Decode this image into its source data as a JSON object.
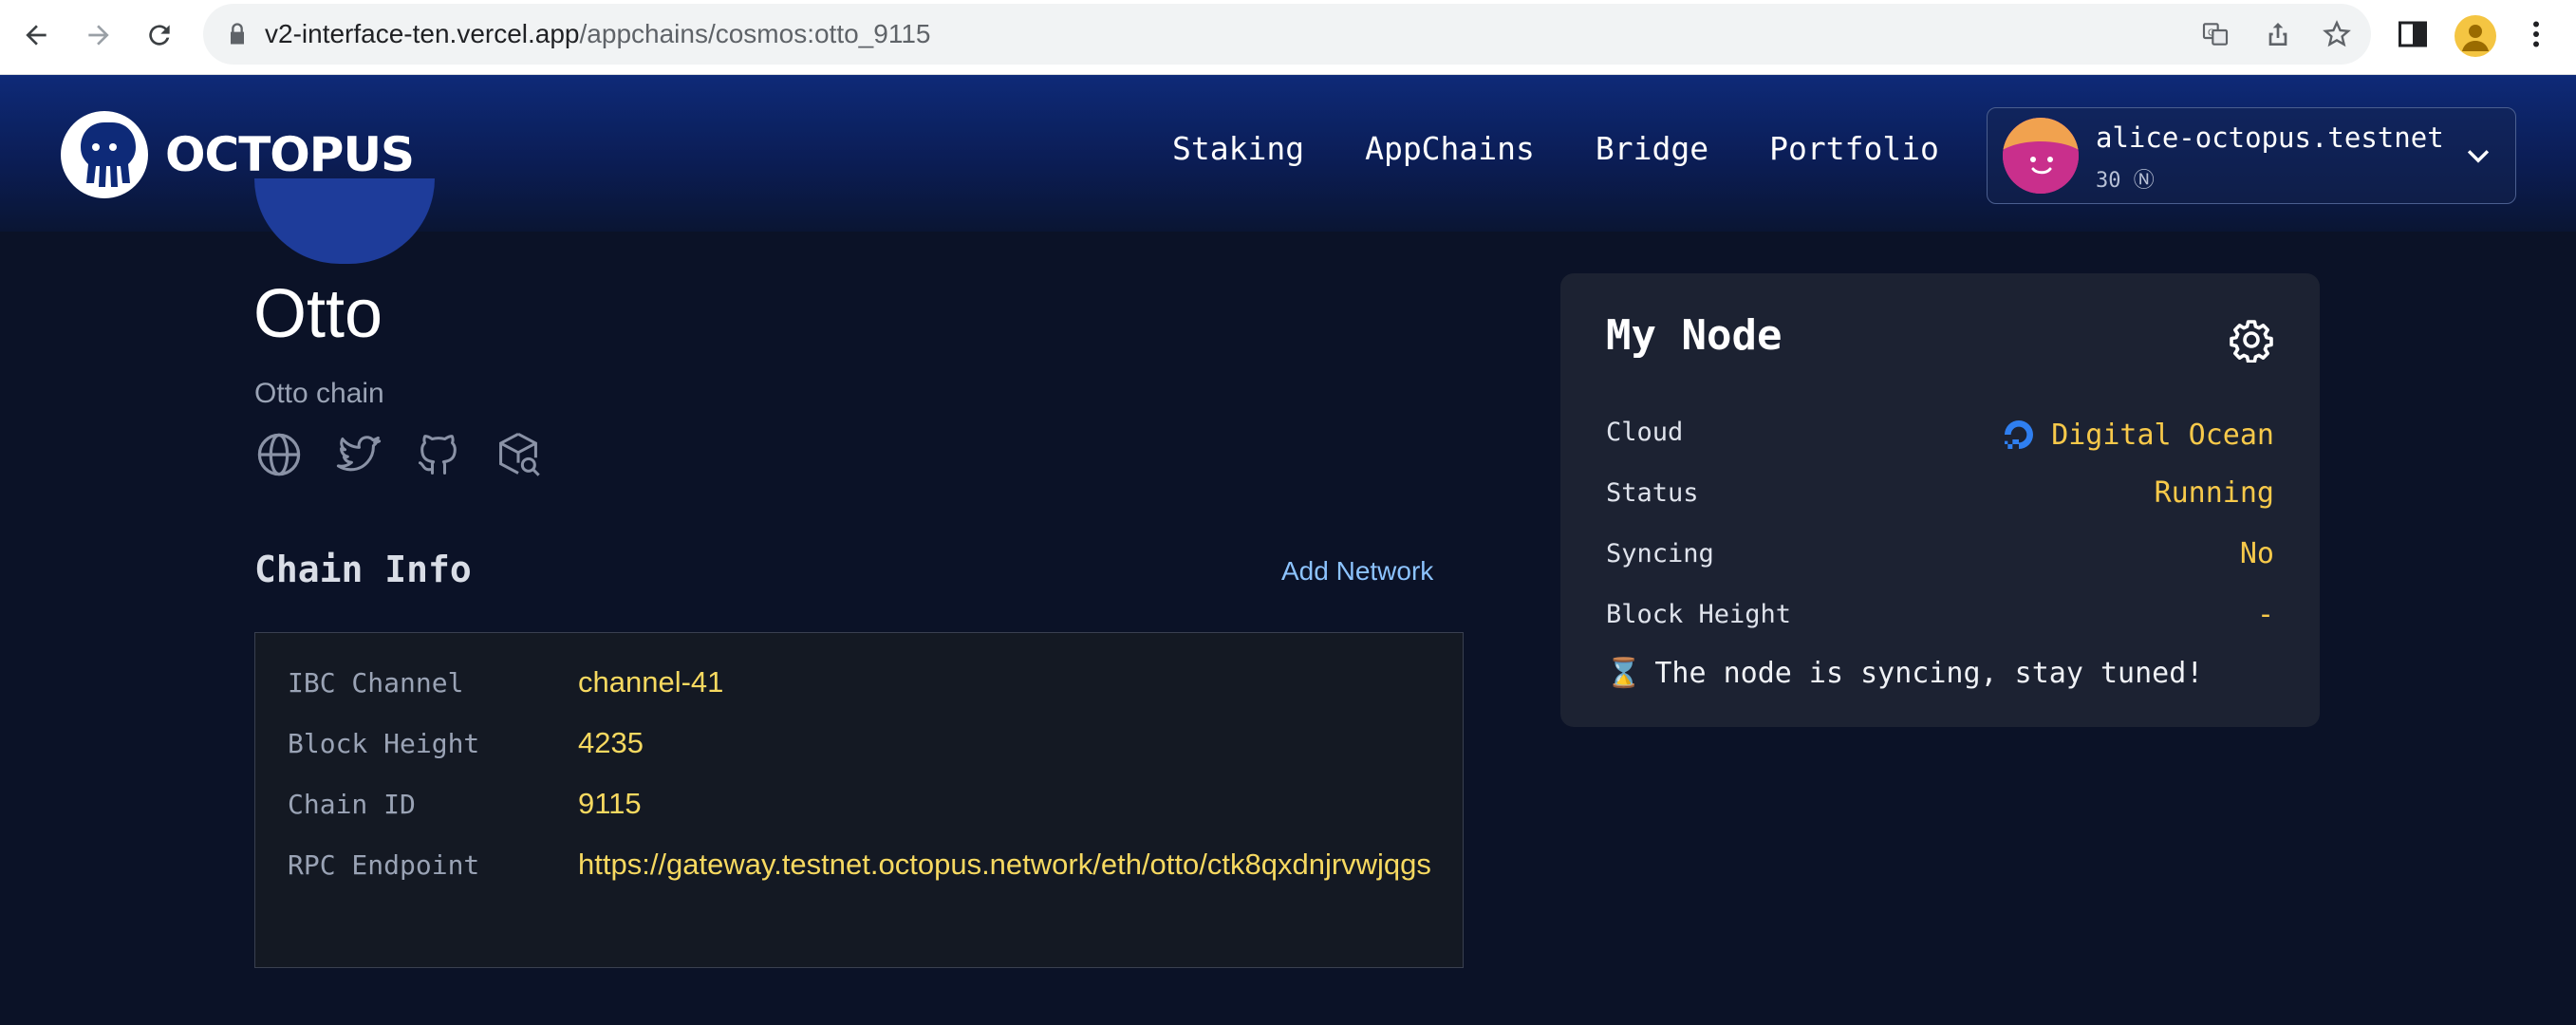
{
  "browser": {
    "url_host": "v2-interface-ten.vercel.app",
    "url_path": "/appchains/cosmos:otto_9115"
  },
  "header": {
    "logo_text": "OCTOPUS",
    "nav": [
      "Staking",
      "AppChains",
      "Bridge",
      "Portfolio"
    ],
    "account": {
      "name": "alice-octopus.testnet",
      "balance": "30 Ⓝ"
    }
  },
  "chain": {
    "title": "Otto",
    "subtitle": "Otto chain",
    "social_icons": [
      "globe-icon",
      "twitter-icon",
      "github-icon",
      "explorer-icon"
    ]
  },
  "chain_info": {
    "title": "Chain Info",
    "add_network": "Add Network",
    "rows": [
      {
        "label": "IBC Channel",
        "value": "channel-41"
      },
      {
        "label": "Block Height",
        "value": "4235"
      },
      {
        "label": "Chain ID",
        "value": "9115"
      },
      {
        "label": "RPC Endpoint",
        "value": "https://gateway.testnet.octopus.network/eth/otto/ctk8qxdnjrvwjqgs"
      }
    ]
  },
  "my_node": {
    "title": "My Node",
    "rows": [
      {
        "label": "Cloud",
        "value": "Digital Ocean"
      },
      {
        "label": "Status",
        "value": "Running"
      },
      {
        "label": "Syncing",
        "value": "No"
      },
      {
        "label": "Block Height",
        "value": "-"
      }
    ],
    "message": "The node is syncing, stay tuned!",
    "message_icon": "⌛"
  },
  "colors": {
    "accent_yellow": "#f7d960",
    "link_blue": "#8cc3ff",
    "background": "#0b1227"
  }
}
